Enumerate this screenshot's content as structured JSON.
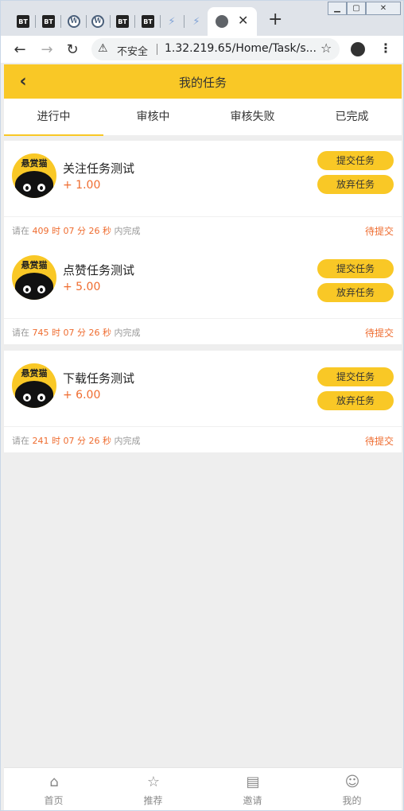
{
  "browser": {
    "tabs": [
      {
        "icon": "bt-icon",
        "label": "BT"
      },
      {
        "icon": "bt-icon",
        "label": "BT"
      },
      {
        "icon": "wordpress-icon",
        "label": "W"
      },
      {
        "icon": "wordpress-icon",
        "label": "W"
      },
      {
        "icon": "bt-icon",
        "label": "BT"
      },
      {
        "icon": "bt-icon",
        "label": "BT"
      },
      {
        "icon": "leaf-icon",
        "label": ""
      },
      {
        "icon": "leaf-icon",
        "label": ""
      }
    ],
    "insecure_label": "不安全",
    "url": "1.32.219.65/Home/Task/s..."
  },
  "header": {
    "title": "我的任务"
  },
  "tabs": [
    {
      "label": "进行中",
      "active": true
    },
    {
      "label": "审核中",
      "active": false
    },
    {
      "label": "审核失败",
      "active": false
    },
    {
      "label": "已完成",
      "active": false
    }
  ],
  "tasks": [
    {
      "avatar_text": "悬赏猫",
      "name": "关注任务测试",
      "reward": "+ 1.00",
      "submit_label": "提交任务",
      "abandon_label": "放弃任务",
      "deadline_prefix": "请在",
      "deadline_time": "409 时 07 分 26 秒",
      "deadline_suffix": "内完成",
      "status": "待提交"
    },
    {
      "avatar_text": "悬赏猫",
      "name": "点赞任务测试",
      "reward": "+ 5.00",
      "submit_label": "提交任务",
      "abandon_label": "放弃任务",
      "deadline_prefix": "请在",
      "deadline_time": "745 时 07 分 26 秒",
      "deadline_suffix": "内完成",
      "status": "待提交"
    },
    {
      "avatar_text": "悬赏猫",
      "name": "下载任务测试",
      "reward": "+ 6.00",
      "submit_label": "提交任务",
      "abandon_label": "放弃任务",
      "deadline_prefix": "请在",
      "deadline_time": "241 时 07 分 26 秒",
      "deadline_suffix": "内完成",
      "status": "待提交"
    }
  ],
  "bottom_nav": [
    {
      "label": "首页",
      "icon": "home-icon"
    },
    {
      "label": "推荐",
      "icon": "star-icon"
    },
    {
      "label": "邀请",
      "icon": "chart-icon"
    },
    {
      "label": "我的",
      "icon": "user-icon"
    }
  ],
  "colors": {
    "accent": "#f9c826",
    "reward": "#ef6c2f",
    "background": "#eeeeee"
  }
}
